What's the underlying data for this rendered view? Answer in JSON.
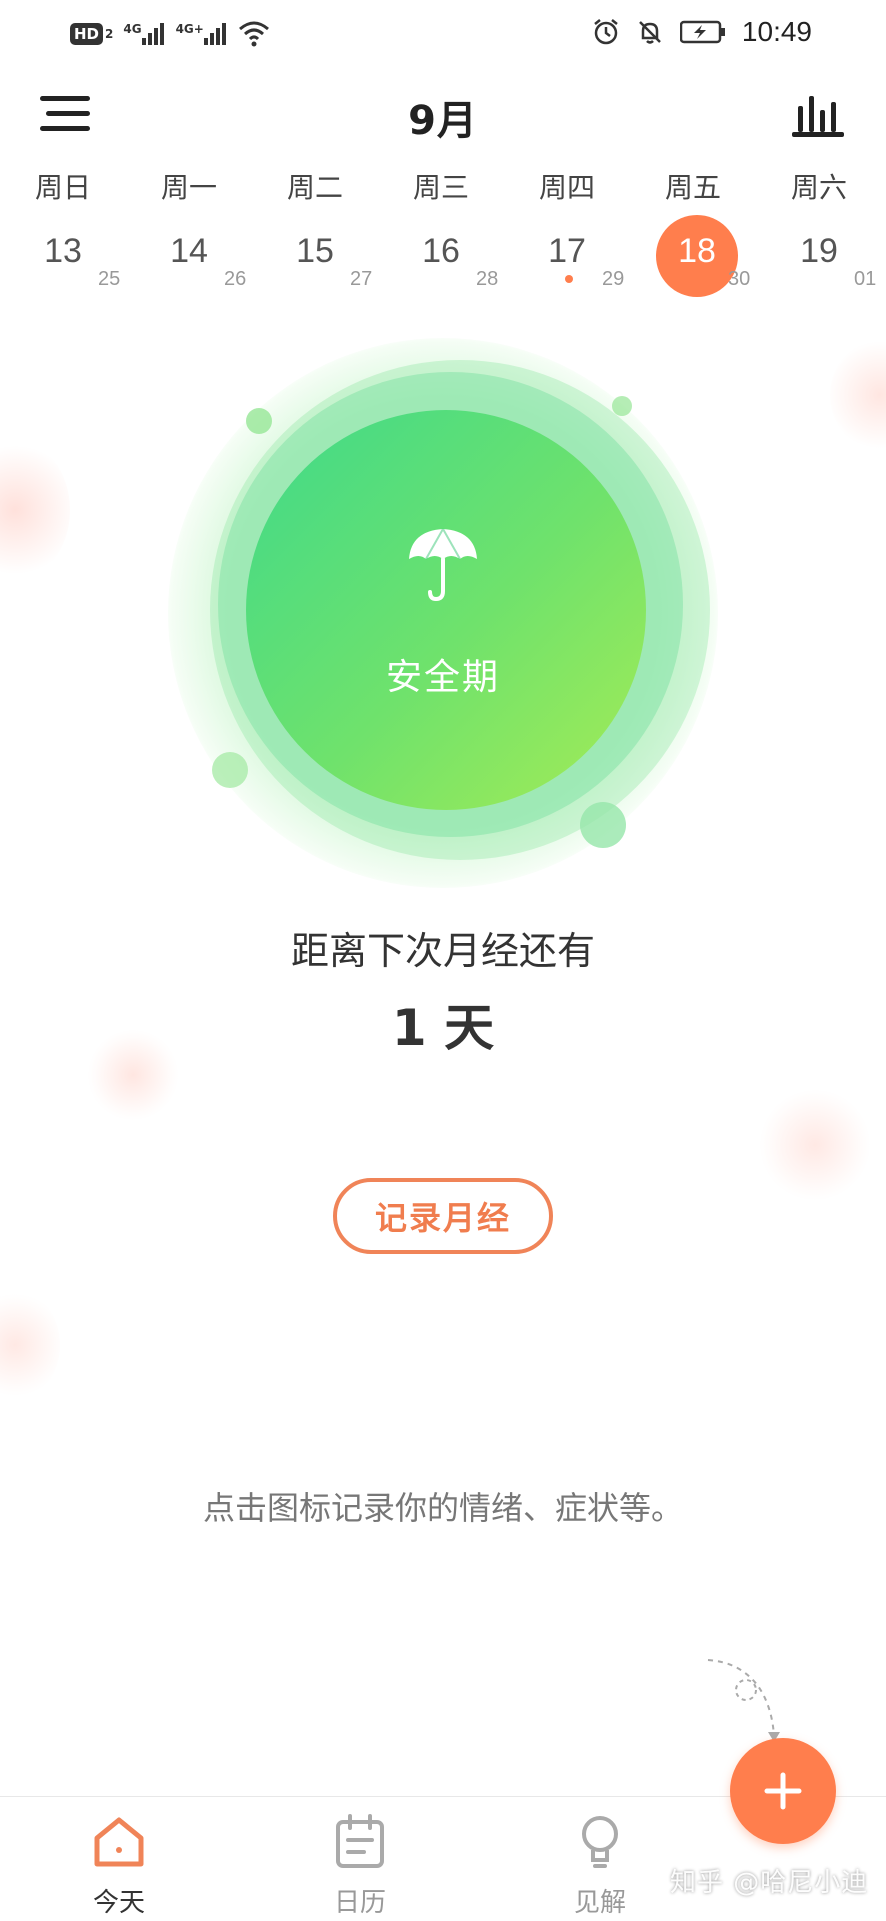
{
  "status_bar": {
    "hd": "HD",
    "hd_sub": "2",
    "net1": "4G",
    "net2": "4G+",
    "time": "10:49",
    "icons": [
      "signal-icon",
      "wifi-icon",
      "alarm-icon",
      "bell-off-icon",
      "battery-charging-icon"
    ]
  },
  "header": {
    "month": "9月",
    "menu_icon": "menu-icon",
    "stats_icon": "bar-chart-icon"
  },
  "week": {
    "days": [
      {
        "weekday": "周日",
        "date": "13",
        "sub": "25"
      },
      {
        "weekday": "周一",
        "date": "14",
        "sub": "26"
      },
      {
        "weekday": "周二",
        "date": "15",
        "sub": "27"
      },
      {
        "weekday": "周三",
        "date": "16",
        "sub": "28"
      },
      {
        "weekday": "周四",
        "date": "17",
        "sub": "29"
      },
      {
        "weekday": "周五",
        "date": "18",
        "sub": "30"
      },
      {
        "weekday": "周六",
        "date": "19",
        "sub": "01"
      }
    ],
    "selected_index": 5,
    "marked_index": 4
  },
  "cycle": {
    "phase_label": "安全期",
    "phase_icon": "umbrella-icon",
    "countdown_label": "距离下次月经还有",
    "countdown_value": "1 天"
  },
  "actions": {
    "record_button": "记录月经",
    "hint": "点击图标记录你的情绪、症状等。"
  },
  "nav": {
    "items": [
      {
        "label": "今天",
        "icon": "home-icon",
        "active": true
      },
      {
        "label": "日历",
        "icon": "calendar-icon",
        "active": false
      },
      {
        "label": "见解",
        "icon": "lightbulb-icon",
        "active": false
      }
    ]
  },
  "fab": {
    "icon": "plus-icon"
  },
  "watermark": "知乎 @哈尼小迪",
  "colors": {
    "accent": "#ff7e4d",
    "green_start": "#3fd98a",
    "green_end": "#a6ec55"
  }
}
